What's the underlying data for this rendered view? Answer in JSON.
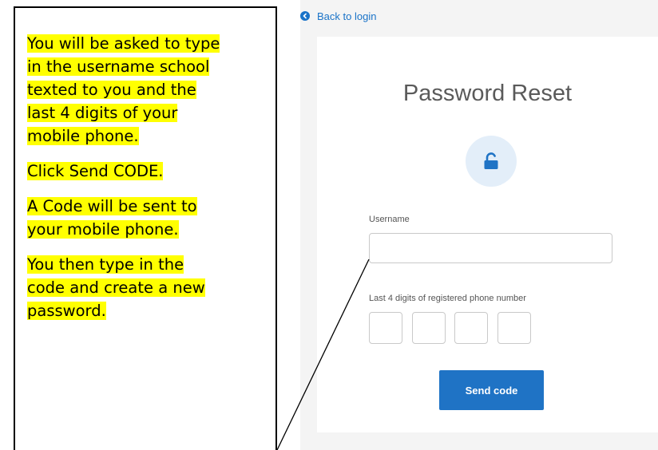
{
  "instructions": [
    [
      "You will be asked to type",
      "in the username school",
      "texted to you and the",
      "last 4 digits of your",
      "mobile phone."
    ],
    [
      "Click Send CODE."
    ],
    [
      "A Code will be sent to",
      "your mobile phone."
    ],
    [
      "You then type in the",
      "code and create a new",
      "password."
    ]
  ],
  "back_link": {
    "label": "Back to login",
    "icon": "chevron-left-icon"
  },
  "reset_form": {
    "title": "Password Reset",
    "lock_icon": "unlock-icon",
    "username_label": "Username",
    "username_value": "",
    "phone_label": "Last 4 digits of registered phone number",
    "digits": [
      "",
      "",
      "",
      ""
    ],
    "send_button": "Send code"
  },
  "colors": {
    "highlight": "#ffff00",
    "accent": "#1f73c5",
    "lock_circle": "#e3eef9"
  }
}
